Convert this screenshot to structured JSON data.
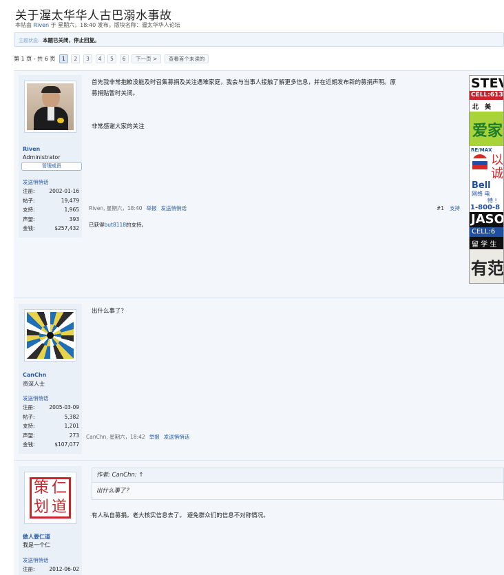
{
  "thread": {
    "title": "关于渥太华华人古巴溺水事故",
    "meta_prefix": "本帖由 ",
    "meta_author": "Riven",
    "meta_suffix": " 于 星期六，18:40 发布。版块名称：渥太华华人论坛"
  },
  "status": {
    "label": "主题状态:",
    "text": "本题已关闭，停止回复。"
  },
  "pagination": {
    "info": "第 1 页 - 共 6 页",
    "pages": [
      "1",
      "2",
      "3",
      "4",
      "5",
      "6"
    ],
    "current": "1",
    "next": "下一页 >",
    "unread": "查看首个未读的"
  },
  "posts": [
    {
      "username": "Riven",
      "user_title": "Administrator",
      "badge": "管理成员",
      "send_msg": "发送悄悄话",
      "stats": [
        {
          "k": "注册:",
          "v": "2002-01-16"
        },
        {
          "k": "帖子:",
          "v": "19,479"
        },
        {
          "k": "支持:",
          "v": "1,965"
        },
        {
          "k": "声望:",
          "v": "393"
        },
        {
          "k": "金钱:",
          "v": "$257,432"
        }
      ],
      "body_line1": "首先我非常抱歉没能及时召集募捐及关注遇难家庭，我会与当事人接触了解更多信息，并在近期发布新的募捐声明。原",
      "body_line2": "募捐贴暂时关闭。",
      "body_line3": "非常感谢大家的关注",
      "footer_meta": "Riven, 星期六，18:40",
      "report": "举报",
      "pm": "发送悄悄话",
      "post_no": "#1",
      "like": "支持",
      "likes_prefix": "已获得",
      "likes_user": "but8118",
      "likes_suffix": "的支持。"
    },
    {
      "username": "CanChn",
      "user_title": "资深人士",
      "send_msg": "发送悄悄话",
      "stats": [
        {
          "k": "注册:",
          "v": "2005-03-09"
        },
        {
          "k": "帖子:",
          "v": "5,382"
        },
        {
          "k": "支持:",
          "v": "1,201"
        },
        {
          "k": "声望:",
          "v": "273"
        },
        {
          "k": "金钱:",
          "v": "$107,077"
        }
      ],
      "body": "出什么事了？",
      "footer_meta": "CanChn, 星期六，18:42",
      "report": "举报",
      "pm": "发送悄悄话"
    },
    {
      "username": "做人要仁道",
      "user_title": "我是一个仁",
      "send_msg": "发送悄悄话",
      "stats": [
        {
          "k": "注册:",
          "v": "2012-06-02"
        }
      ],
      "quote_head": "作者: CanChn: ↑",
      "quote_body": "出什么事了？",
      "body": "有人私自募捐。老大核实信息去了。 避免群众们的信息不对称情况。",
      "seal_chars": [
        "策",
        "仁",
        "划",
        "道"
      ]
    }
  ],
  "ads": [
    {
      "text": "STEV",
      "sub": "CELL:613",
      "sub2": "北　美"
    },
    {
      "text": "爱家"
    },
    {
      "text": "RE/MAX",
      "sub": "以",
      "sub2": "诚"
    },
    {
      "text": "Bell",
      "sub": "网络 电",
      "sub2": "特 !",
      "sub3": "1-800-8"
    },
    {
      "text": "JASO",
      "sub": "CELL:6",
      "sub2": "留 学 生"
    },
    {
      "text": "有范"
    }
  ],
  "colors": {
    "link": "#2a5aa7",
    "post_bg": "#f3f7fc",
    "user_panel": "#e9f0f8",
    "border": "#dce6f1"
  }
}
